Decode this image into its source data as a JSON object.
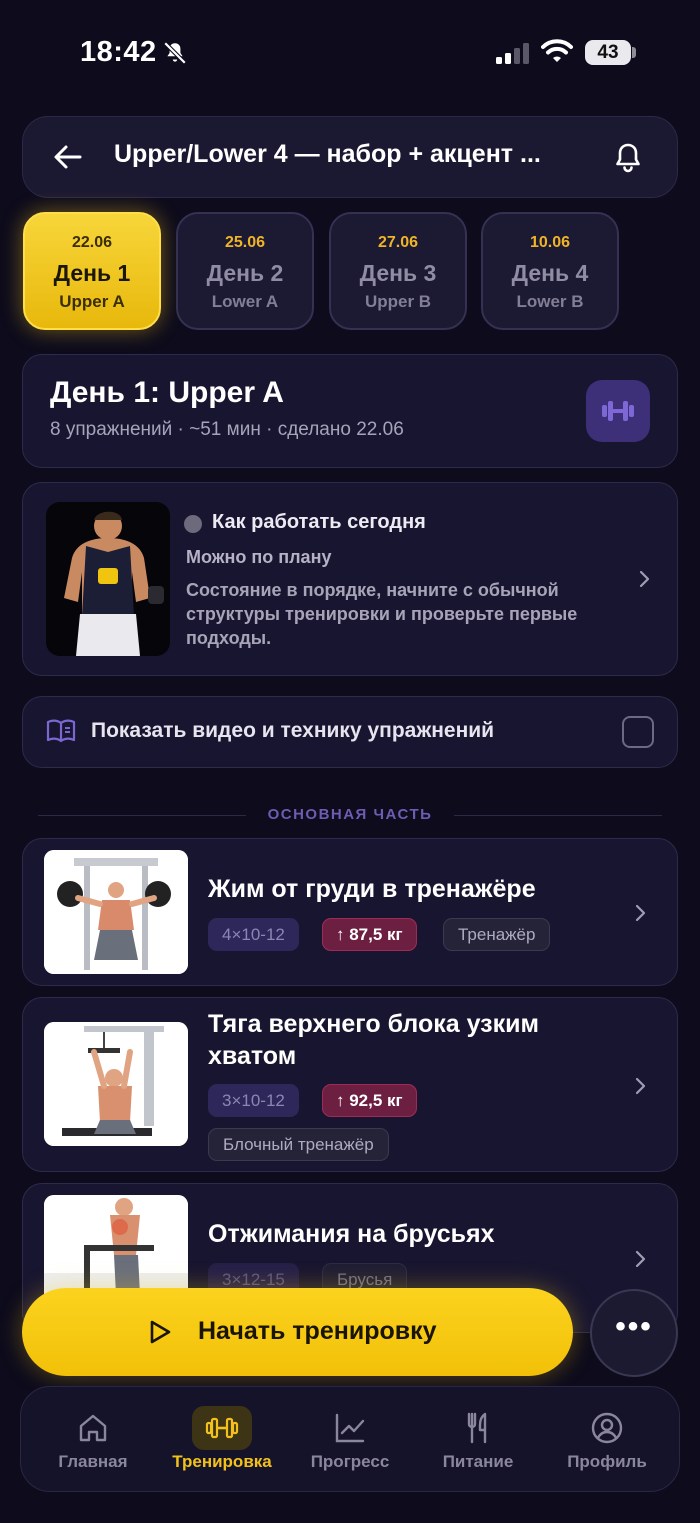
{
  "status_bar": {
    "time": "18:42",
    "battery": "43"
  },
  "header": {
    "title": "Upper/Lower 4 — набор + акцент ..."
  },
  "day_tabs": [
    {
      "date": "22.06",
      "name": "День 1",
      "sub": "Upper A"
    },
    {
      "date": "25.06",
      "name": "День 2",
      "sub": "Lower A"
    },
    {
      "date": "27.06",
      "name": "День 3",
      "sub": "Upper B"
    },
    {
      "date": "10.06",
      "name": "День 4",
      "sub": "Lower B"
    }
  ],
  "day_card": {
    "title": "День 1: Upper A",
    "meta": "8 упражнений · ~51 мин · сделано 22.06"
  },
  "advice": {
    "heading": "Как работать сегодня",
    "subheading": "Можно по плану",
    "text": "Состояние в порядке, начните с обычной структуры тренировки и проверьте первые подходы."
  },
  "video_toggle": {
    "label": "Показать видео и технику упражнений"
  },
  "section": {
    "label": "ОСНОВНАЯ ЧАСТЬ"
  },
  "exercises": [
    {
      "title": "Жим от груди в тренажёре",
      "sets": "4×10-12",
      "weight": "↑ 87,5 кг",
      "equipment": "Тренажёр"
    },
    {
      "title": "Тяга верхнего блока узким хватом",
      "sets": "3×10-12",
      "weight": "↑ 92,5 кг",
      "equipment": "Блочный тренажёр"
    },
    {
      "title": "Отжимания на брусьях",
      "sets": "3×12-15",
      "equipment": "Брусья"
    }
  ],
  "start_button": {
    "label": "Начать тренировку"
  },
  "more_button": {
    "label": "•••"
  },
  "bottom_nav": [
    {
      "label": "Главная"
    },
    {
      "label": "Тренировка"
    },
    {
      "label": "Прогресс"
    },
    {
      "label": "Питание"
    },
    {
      "label": "Профиль"
    }
  ],
  "colors": {
    "accent": "#f3c21a",
    "background": "#0d0b1c",
    "weight_chip": "#6d1f42"
  }
}
